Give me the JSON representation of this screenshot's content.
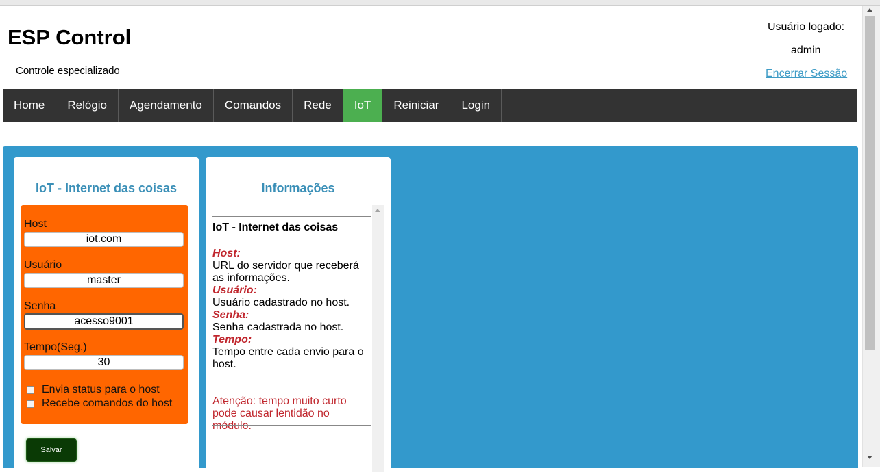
{
  "header": {
    "title": "ESP Control",
    "subtitle": "Controle especializado",
    "user_label": "Usuário logado:",
    "user_name": "admin",
    "logout_label": "Encerrar Sessão"
  },
  "nav": {
    "items": [
      "Home",
      "Relógio",
      "Agendamento",
      "Comandos",
      "Rede",
      "IoT",
      "Reiniciar",
      "Login"
    ],
    "active": "IoT",
    "active_color": "#4caf50",
    "bar_color": "#333333"
  },
  "iot_form": {
    "title": "IoT - Internet das coisas",
    "host_label": "Host",
    "host_value": "iot.com",
    "user_label": "Usuário",
    "user_value": "master",
    "password_label": "Senha",
    "password_value": "acesso9001",
    "time_label": "Tempo(Seg.)",
    "time_value": "30",
    "send_status_label": "Envia status para o host",
    "send_status_checked": false,
    "receive_commands_label": "Recebe comandos do host",
    "receive_commands_checked": false,
    "save_label": "Salvar",
    "panel_color": "#ff6600"
  },
  "info": {
    "title": "Informações",
    "heading": "IoT - Internet das coisas",
    "host_key": "Host:",
    "host_desc": "URL do servidor que receberá as informações.",
    "user_key": "Usuário:",
    "user_desc": "Usuário cadastrado no host.",
    "password_key": "Senha:",
    "password_desc": "Senha cadastrada no host.",
    "time_key": "Tempo:",
    "time_desc": "Tempo entre cada envio para o host.",
    "warning": "Atenção: tempo muito curto pode causar lentidão no módulo."
  },
  "colors": {
    "main_bg": "#3399cc",
    "title_blue": "#3a8fb7",
    "key_red": "#c0262d",
    "save_bg": "#0a3a05"
  }
}
